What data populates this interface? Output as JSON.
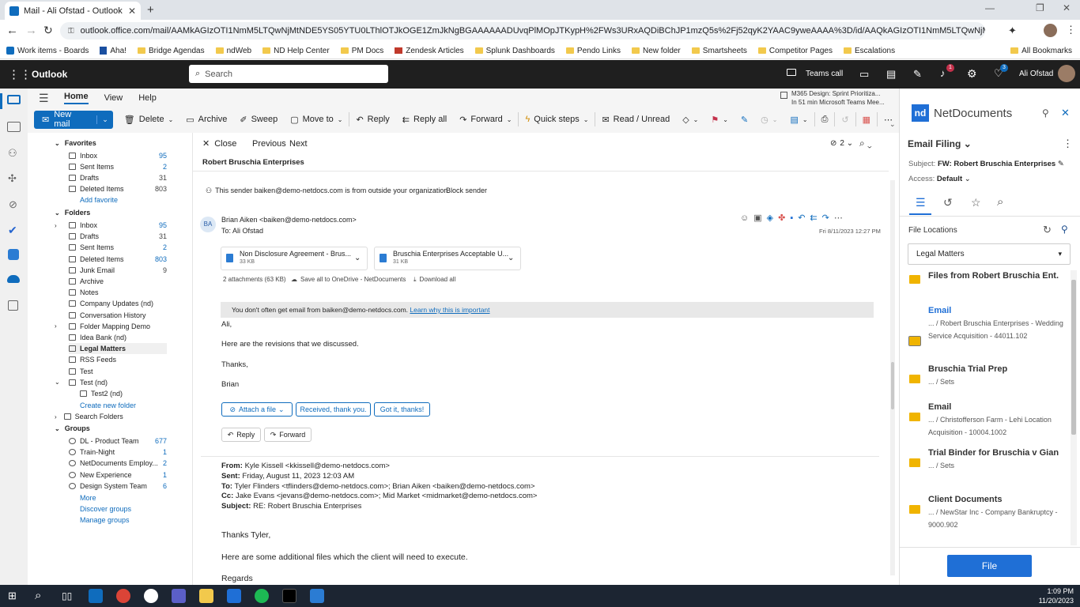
{
  "browser": {
    "tab_title": "Mail - Ali Ofstad - Outlook",
    "url": "outlook.office.com/mail/AAMkAGIzOTI1NmM5LTQwNjMtNDE5YS05YTU0LThlOTJkOGE1ZmJkNgBGAAAAAADUvqPlMOpJTKypH%2FWs3URxAQDiBChJP1mzQ5s%2Fj52qyK2YAAC9yweAAAA%3D/id/AAQkAGIzOTI1NmM5LTQwNjMtNDE5YS05YTU..."
  },
  "bookmarks": [
    "Work items - Boards",
    "Aha!",
    "Bridge Agendas",
    "ndWeb",
    "ND Help Center",
    "PM Docs",
    "Zendesk Articles",
    "Splunk Dashboards",
    "Pendo Links",
    "New folder",
    "Smartsheets",
    "Competitor Pages",
    "Escalations",
    "All Bookmarks"
  ],
  "header": {
    "app": "Outlook",
    "search_placeholder": "Search",
    "teams_call": "Teams call",
    "user": "Ali Ofstad",
    "bell_badge": "1",
    "tips_badge": "3"
  },
  "ribbon": {
    "tabs": [
      "Home",
      "View",
      "Help"
    ],
    "new_mail": "New mail",
    "delete": "Delete",
    "archive": "Archive",
    "sweep": "Sweep",
    "move_to": "Move to",
    "reply": "Reply",
    "reply_all": "Reply all",
    "forward": "Forward",
    "quick_steps": "Quick steps",
    "read_unread": "Read / Unread",
    "meeting_title": "M365 Design: Sprint Prioritiza...",
    "meeting_sub": "In 51 min Microsoft Teams Mee..."
  },
  "folders": {
    "favorites_label": "Favorites",
    "favorites": [
      {
        "name": "Inbox",
        "count": "95",
        "blue": true
      },
      {
        "name": "Sent Items",
        "count": "2",
        "blue": true
      },
      {
        "name": "Drafts",
        "count": "31",
        "blue": false
      },
      {
        "name": "Deleted Items",
        "count": "803",
        "blue": false
      }
    ],
    "add_favorite": "Add favorite",
    "folders_label": "Folders",
    "list": [
      {
        "name": "Inbox",
        "count": "95",
        "blue": true
      },
      {
        "name": "Drafts",
        "count": "31",
        "blue": false
      },
      {
        "name": "Sent Items",
        "count": "2",
        "blue": true
      },
      {
        "name": "Deleted Items",
        "count": "803",
        "blue": true
      },
      {
        "name": "Junk Email",
        "count": "9",
        "blue": false
      },
      {
        "name": "Archive",
        "count": "",
        "blue": false
      },
      {
        "name": "Notes",
        "count": "",
        "blue": false
      },
      {
        "name": "Company Updates (nd)",
        "count": "",
        "blue": false
      },
      {
        "name": "Conversation History",
        "count": "",
        "blue": false
      },
      {
        "name": "Folder Mapping Demo",
        "count": "",
        "blue": false
      },
      {
        "name": "Idea Bank (nd)",
        "count": "",
        "blue": false
      },
      {
        "name": "Legal Matters",
        "count": "",
        "blue": false
      },
      {
        "name": "RSS Feeds",
        "count": "",
        "blue": false
      },
      {
        "name": "Test",
        "count": "",
        "blue": false
      },
      {
        "name": "Test (nd)",
        "count": "",
        "blue": false
      },
      {
        "name": "Test2 (nd)",
        "count": "",
        "blue": false
      }
    ],
    "create_new_folder": "Create new folder",
    "search_folders": "Search Folders",
    "groups_label": "Groups",
    "groups": [
      {
        "name": "DL - Product Team",
        "count": "677"
      },
      {
        "name": "Train-Night",
        "count": "1"
      },
      {
        "name": "NetDocuments Employ...",
        "count": "2"
      },
      {
        "name": "New Experience",
        "count": "1"
      },
      {
        "name": "Design System Team",
        "count": "6"
      }
    ],
    "more": "More",
    "discover_groups": "Discover groups",
    "manage_groups": "Manage groups"
  },
  "reading": {
    "close": "Close",
    "previous": "Previous",
    "next": "Next",
    "thread_count": "2",
    "subject": "Robert Bruschia Enterprises",
    "external_notice": "This sender baiken@demo-netdocs.com is from outside your organization.",
    "block_sender": "Block sender",
    "avatar": "BA",
    "from": "Brian Aiken <baiken@demo-netdocs.com>",
    "to": "To:  Ali Ofstad",
    "date": "Fri 8/11/2023 12:27 PM",
    "attachments": [
      {
        "name": "Non Disclosure Agreement - Brus...",
        "size": "33 KB"
      },
      {
        "name": "Bruschia Enterprises Acceptable U...",
        "size": "31 KB"
      }
    ],
    "att_summary": "2 attachments (63 KB)",
    "save_all": "Save all to OneDrive - NetDocuments",
    "download_all": "Download all",
    "notice": "You don't often get email from baiken@demo-netdocs.com.",
    "notice_link": "Learn why this is important",
    "body1": "Ali,",
    "body2": "Here are the revisions that we discussed.",
    "body3": "Thanks,",
    "body4": "Brian",
    "suggest1": "Attach a file",
    "suggest2": "Received, thank you.",
    "suggest3": "Got it, thanks!",
    "reply": "Reply",
    "forward": "Forward",
    "q_from_label": "From:",
    "q_from": "Kyle Kissell <kkissell@demo-netdocs.com>",
    "q_sent_label": "Sent:",
    "q_sent": "Friday, August 11, 2023 12:03 AM",
    "q_to_label": "To:",
    "q_to": "Tyler Flinders <tflinders@demo-netdocs.com>; Brian Aiken <baiken@demo-netdocs.com>",
    "q_cc_label": "Cc:",
    "q_cc": "Jake Evans <jevans@demo-netdocs.com>; Mid Market <midmarket@demo-netdocs.com>",
    "q_subject_label": "Subject:",
    "q_subject": "RE: Robert Bruschia Enterprises",
    "q_body1": "Thanks Tyler,",
    "q_body2": "Here are some additional files which the client will need to execute.",
    "q_body3": "Regards"
  },
  "netdocs": {
    "brand": "NetDocuments",
    "logo": "nd",
    "title": "Email Filing",
    "subject_label": "Subject:",
    "subject": "FW: Robert Bruschia Enterprises",
    "access_label": "Access:",
    "access": "Default",
    "file_locations": "File Locations",
    "dropdown": "Legal Matters",
    "items": [
      {
        "title": "Files from Robert Bruschia Ent.",
        "path": ""
      },
      {
        "title": "Email",
        "path": "... / Robert Bruschia Enterprises - Wedding Service Acquisition - 44011.102"
      },
      {
        "title": "Bruschia Trial Prep",
        "path": "... / Sets"
      },
      {
        "title": "Email",
        "path": "... / Christofferson Farm - Lehi Location Acquisition - 10004.1002"
      },
      {
        "title": "Trial Binder for Bruschia v Gian",
        "path": "... / Sets"
      },
      {
        "title": "Client Documents",
        "path": "... / NewStar Inc - Company Bankruptcy - 9000.902"
      }
    ],
    "file_button": "File"
  },
  "taskbar": {
    "time": "1:09 PM",
    "date": "11/20/2023"
  },
  "colors": {
    "accent": "#0f6cbd",
    "nd_blue": "#1f6fd6",
    "folder_yellow": "#f0b400"
  }
}
